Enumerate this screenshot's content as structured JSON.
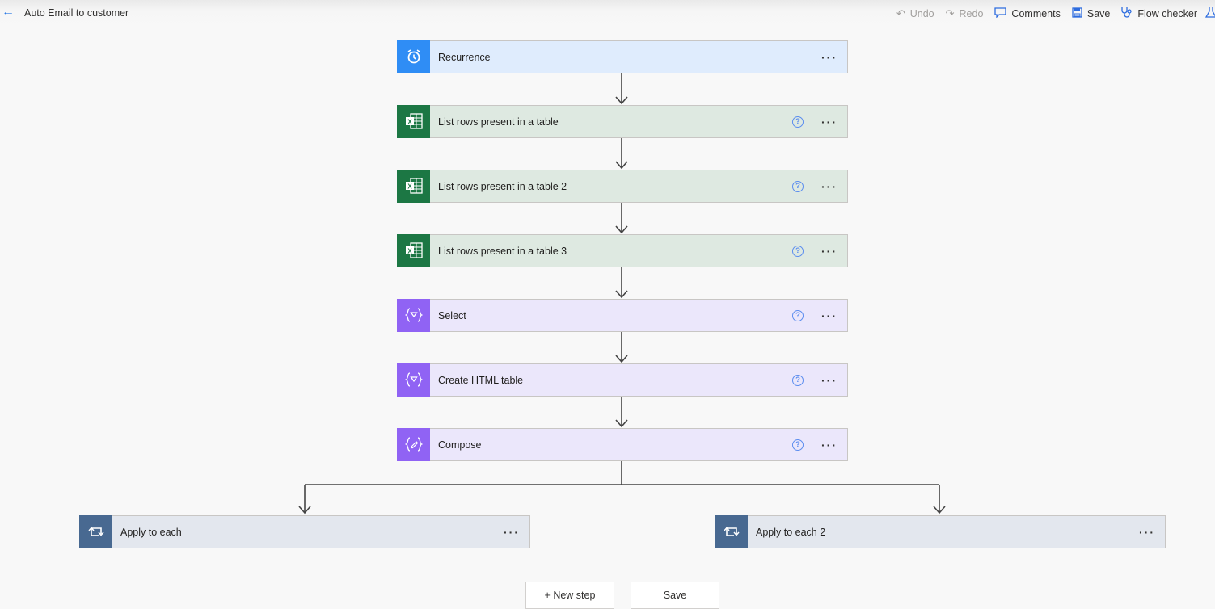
{
  "header": {
    "back_icon": "arrow-left-icon",
    "title": "Auto Email to customer",
    "toolbar": {
      "undo": "Undo",
      "redo": "Redo",
      "comments": "Comments",
      "save": "Save",
      "flow_checker": "Flow checker"
    }
  },
  "steps": [
    {
      "label": "Recurrence",
      "icon": "alarm-clock-icon",
      "help": false
    },
    {
      "label": "List rows present in a table",
      "icon": "excel-icon",
      "help": true
    },
    {
      "label": "List rows present in a table 2",
      "icon": "excel-icon",
      "help": true
    },
    {
      "label": "List rows present in a table 3",
      "icon": "excel-icon",
      "help": true
    },
    {
      "label": "Select",
      "icon": "data-operation-icon",
      "help": true
    },
    {
      "label": "Create HTML table",
      "icon": "data-operation-icon",
      "help": true
    },
    {
      "label": "Compose",
      "icon": "compose-icon",
      "help": true
    }
  ],
  "branches": [
    {
      "label": "Apply to each",
      "icon": "loop-icon"
    },
    {
      "label": "Apply to each 2",
      "icon": "loop-icon"
    }
  ],
  "glyphs": {
    "help": "?",
    "more": "···",
    "back": "←",
    "undo": "↶",
    "redo": "↷"
  },
  "footer": {
    "new_step": "+ New step",
    "save": "Save"
  }
}
